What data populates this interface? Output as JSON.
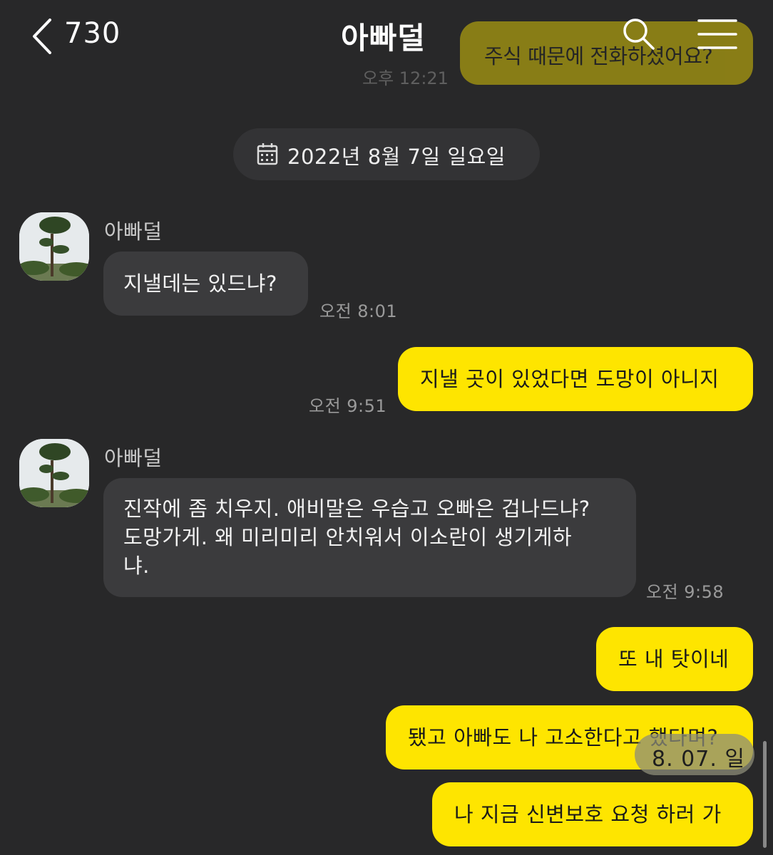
{
  "header": {
    "unread_count": "730",
    "title": "아빠덜"
  },
  "previous": {
    "text": "주식 때문에 전화하셨어요?",
    "time": "오후 12:21"
  },
  "date_divider": "2022년 8월 7일 일요일",
  "messages": [
    {
      "direction": "in",
      "sender": "아빠덜",
      "text": "지낼데는 있드냐?",
      "time": "오전 8:01"
    },
    {
      "direction": "out",
      "text": "지낼 곳이 있었다면 도망이 아니지",
      "time": "오전 9:51"
    },
    {
      "direction": "in",
      "sender": "아빠덜",
      "lines": [
        "진작에 좀 치우지. 애비말은 우습고 오빠은 겁나드냐?",
        "도망가게. 왜 미리미리 안치워서 이소란이 생기게하",
        "냐."
      ],
      "time": "오전 9:58"
    },
    {
      "direction": "out",
      "text": "또 내 탓이네"
    },
    {
      "direction": "out",
      "text": "됐고 아빠도 나 고소한다고 했다며?"
    },
    {
      "direction": "out",
      "text": "나 지금 신변보호 요청 하러 가"
    }
  ],
  "date_overlay": "8. 07. 일",
  "colors": {
    "background": "#282829",
    "outgoing_bubble": "#FEE500",
    "incoming_bubble": "#3b3b3d"
  }
}
